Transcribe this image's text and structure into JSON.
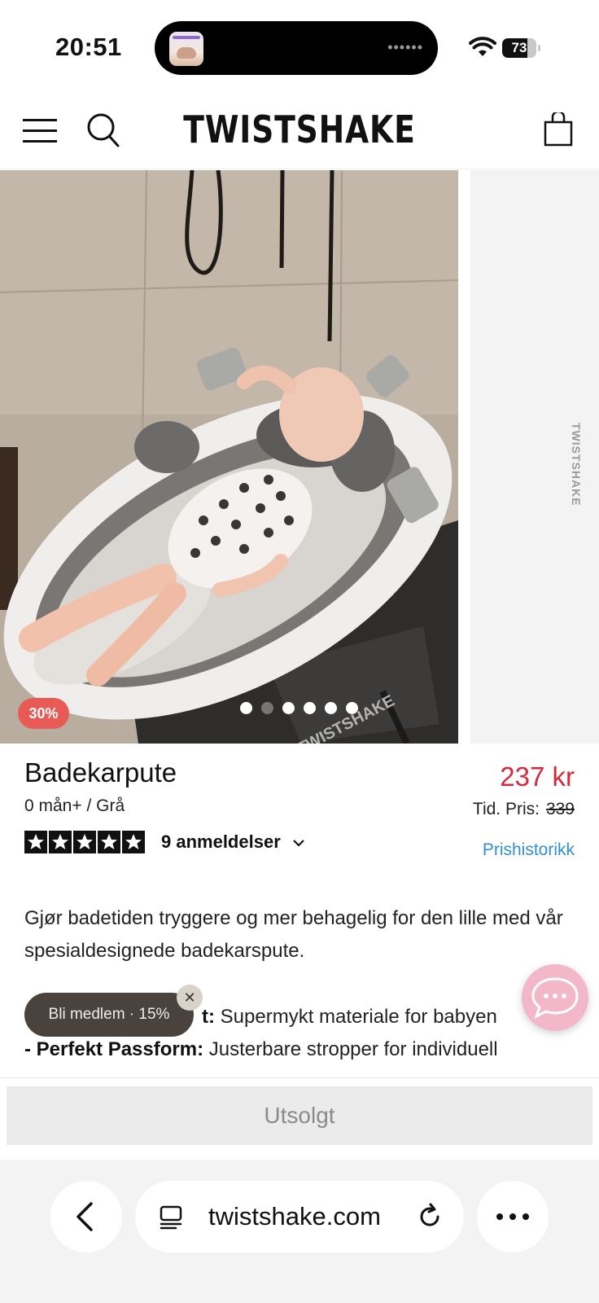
{
  "status_bar": {
    "time": "20:51",
    "battery": "73",
    "battery_level": 0.73,
    "island_icon": "baby-sleep-app-icon",
    "island_dots": "••••••"
  },
  "header": {
    "logo": "TWISTSHAKE",
    "menu_icon": "hamburger-menu-icon",
    "search_icon": "search-icon",
    "bag_icon": "shopping-bag-icon"
  },
  "gallery": {
    "discount_badge": "30%",
    "slide_count": 6,
    "active_slide": 1,
    "tub_brand": "TWISTSHAKE",
    "next_slide_brand": "TWISTSHAKE"
  },
  "product": {
    "title": "Badekarpute",
    "variant": "0 mån+ / Grå",
    "price": "237 kr",
    "old_price_label": "Tid. Pris:",
    "old_price": "339",
    "rating": 5,
    "reviews": "9 anmeldelser",
    "price_history": "Prishistorikk",
    "description": "Gjør badetiden tryggere og mer behagelig for den lille med vår spesialdesignede badekarspute.",
    "feature_1_visible_suffix": "t:",
    "feature_1_text": " Supermykt materiale for babyen",
    "feature_2_label": "- Perfekt Passform:",
    "feature_2_text": " Justerbare stropper for individuell"
  },
  "member_popup": {
    "label": "Bli medlem · 15%",
    "close": "✕"
  },
  "chat": {
    "icon": "chat-bubble-icon"
  },
  "cta": {
    "soldout_label": "Utsolgt"
  },
  "browser": {
    "url": "twistshake.com",
    "back_icon": "back-chevron-icon",
    "reader_icon": "reader-mode-icon",
    "reload_icon": "reload-icon",
    "more_icon": "more-dots-icon"
  },
  "colors": {
    "price_red": "#d9283a",
    "badge_red": "#e85a55",
    "link_blue": "#2f8fd8",
    "member_pill": "#4a433d",
    "chat_pink": "#f2b7c9"
  }
}
